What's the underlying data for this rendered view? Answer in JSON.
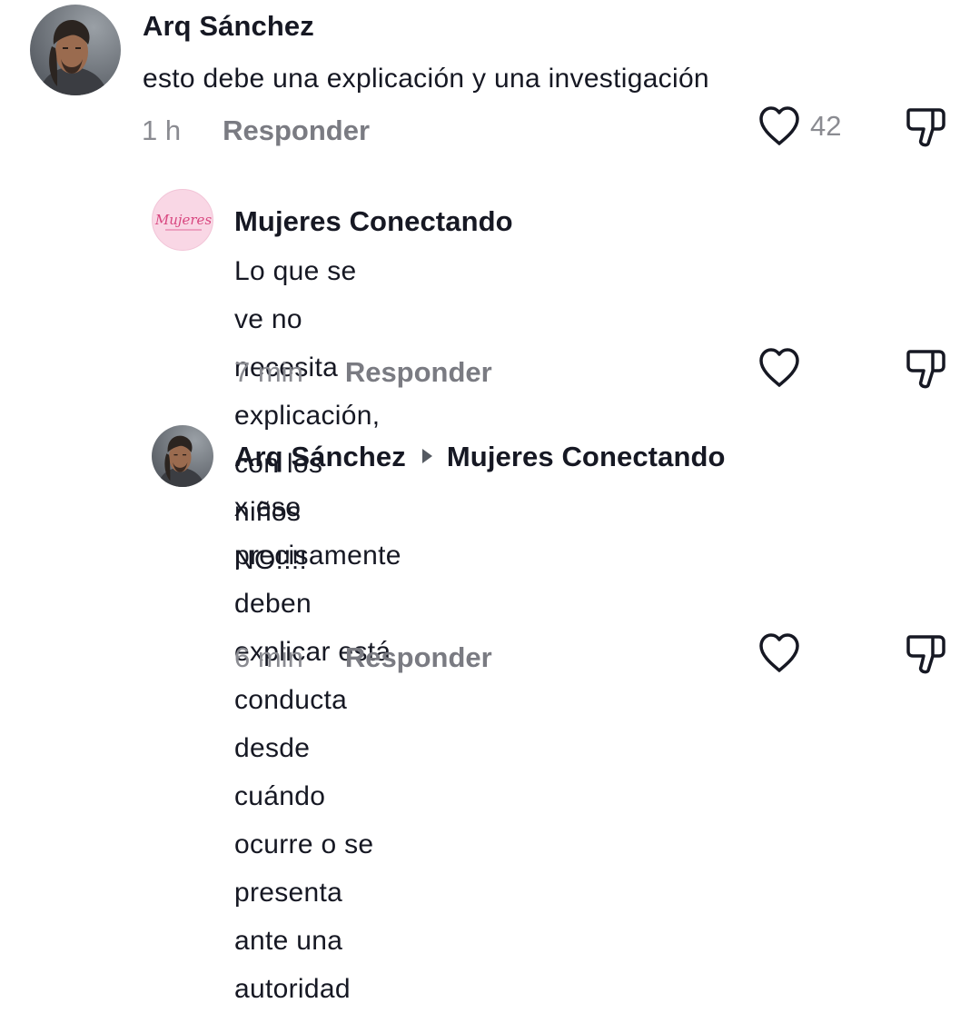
{
  "comments": [
    {
      "username": "Arq Sánchez",
      "reply_to": "",
      "text": "esto debe una explicación y una investigación",
      "time": "1 h",
      "reply_label": "Responder",
      "likes": "42",
      "avatar": "man-portrait"
    },
    {
      "username": "Mujeres Conectando",
      "reply_to": "",
      "text_lines": [
        "Lo que se ve no necesita explicación, con los",
        "niños NO!!!!"
      ],
      "time": "7 min",
      "reply_label": "Responder",
      "likes": "",
      "avatar": "mujeres-logo",
      "avatar_logo_text": "Mujeres"
    },
    {
      "username": "Arq Sánchez",
      "reply_to": "Mujeres Conectando",
      "text_lines": [
        "x eso precisamente deben explicar está conducta",
        "desde cuándo ocurre o se presenta ante una",
        "autoridad"
      ],
      "time": "6 min",
      "reply_label": "Responder",
      "likes": "",
      "avatar": "man-portrait"
    }
  ],
  "icons": {
    "like": "heart-outline-icon",
    "dislike": "thumbs-down-outline-icon",
    "reply_arrow": "triangle-right-icon"
  },
  "colors": {
    "text": "#161823",
    "meta": "#8a8b91",
    "icon": "#161823",
    "logo_bg": "#f9d7e5",
    "logo_text": "#d8467f"
  }
}
